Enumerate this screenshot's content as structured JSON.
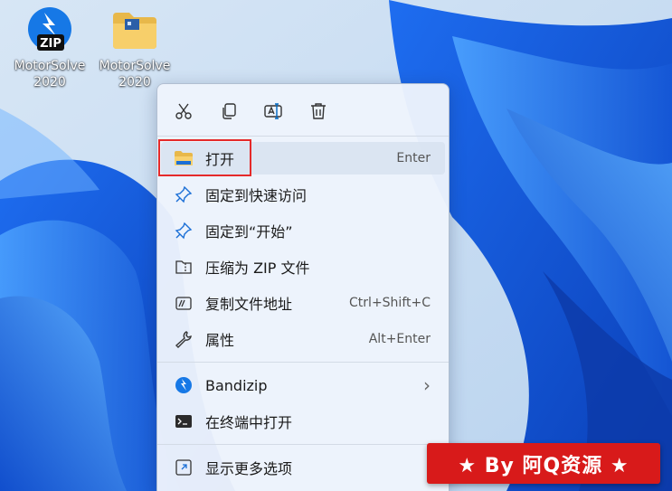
{
  "desktop": {
    "icons": [
      {
        "label": "MotorSolve\n2020",
        "icon": "bandizip-zip-file-icon"
      },
      {
        "label": "MotorSolve\n2020",
        "icon": "folder-icon"
      }
    ],
    "zip_badge": "ZIP"
  },
  "menu": {
    "quick_actions": [
      {
        "icon": "cut-icon"
      },
      {
        "icon": "copy-icon"
      },
      {
        "icon": "rename-icon"
      },
      {
        "icon": "delete-icon"
      }
    ],
    "items": [
      {
        "label": "打开",
        "shortcut": "Enter",
        "icon": "folder-open-icon"
      },
      {
        "label": "固定到快速访问",
        "shortcut": "",
        "icon": "pin-icon"
      },
      {
        "label": "固定到“开始”",
        "shortcut": "",
        "icon": "pin-start-icon"
      },
      {
        "label": "压缩为 ZIP 文件",
        "shortcut": "",
        "icon": "zip-compress-icon"
      },
      {
        "label": "复制文件地址",
        "shortcut": "Ctrl+Shift+C",
        "icon": "copy-path-icon"
      },
      {
        "label": "属性",
        "shortcut": "Alt+Enter",
        "icon": "wrench-icon"
      },
      {
        "label": "Bandizip",
        "shortcut": "",
        "icon": "bandizip-icon",
        "submenu": true
      },
      {
        "label": "在终端中打开",
        "shortcut": "",
        "icon": "terminal-icon"
      },
      {
        "label": "显示更多选项",
        "shortcut": "",
        "icon": "more-options-icon"
      }
    ],
    "submenu_arrow": "›"
  },
  "watermark": {
    "text": "★ By 阿Q资源 ★"
  },
  "colors": {
    "accent": "#0067c0",
    "highlight_border": "#e52a2a",
    "banner": "#d81a1a"
  }
}
